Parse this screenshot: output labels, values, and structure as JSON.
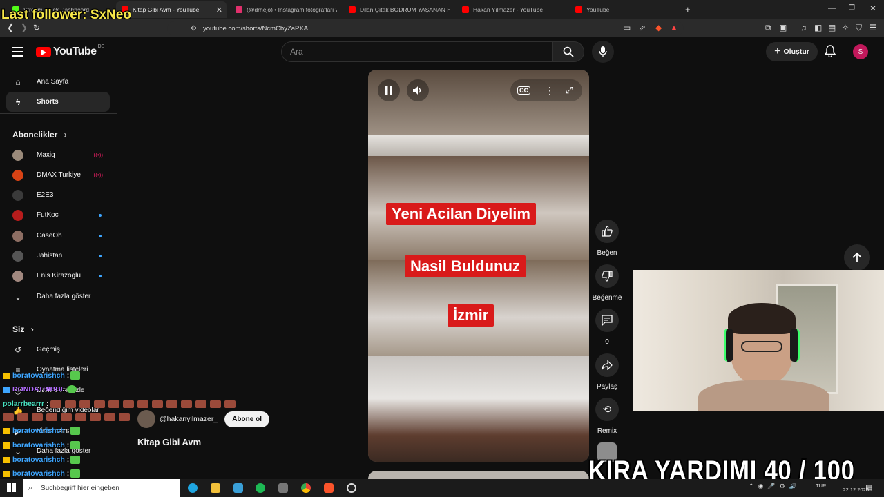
{
  "overlay": {
    "last_follower": "Last follower: SxNeo",
    "goal": "KIRA YARDIMI  40 / 100"
  },
  "browser": {
    "tabs": [
      {
        "label": "Stream - Kick Dashboard",
        "color": "#53fc18",
        "active": false
      },
      {
        "label": "Kitap Gibi Avm - YouTube",
        "color": "#ff0000",
        "active": true
      },
      {
        "label": "(@drhejo) • Instagram fotoğrafları ve",
        "color": "#e1306c",
        "active": false
      },
      {
        "label": "Dilan Çıtak BODRUM YAŞANAN Had",
        "color": "#ff0000",
        "active": false
      },
      {
        "label": "Hakan Yılmazer - YouTube",
        "color": "#ff0000",
        "active": false
      },
      {
        "label": "YouTube",
        "color": "#ff0000",
        "active": false
      }
    ],
    "url": "youtube.com/shorts/NcmCbyZaPXA"
  },
  "youtube": {
    "logo_text": "YouTube",
    "country": "DE",
    "search_placeholder": "Ara",
    "create_label": "Oluştur",
    "avatar_letter": "S",
    "sidebar": {
      "items": [
        {
          "label": "Ana Sayfa",
          "icon": "home-icon"
        },
        {
          "label": "Shorts",
          "icon": "shorts-icon"
        }
      ],
      "subscriptions_title": "Abonelikler",
      "channels": [
        {
          "label": "Maxiq",
          "color": "#9a8a7a",
          "status": "live"
        },
        {
          "label": "DMAX Turkiye",
          "color": "#d84315",
          "status": "live"
        },
        {
          "label": "E2E3",
          "color": "#3a3a3a",
          "status": "none"
        },
        {
          "label": "FutKoc",
          "color": "#b71c1c",
          "status": "new"
        },
        {
          "label": "CaseOh",
          "color": "#8d6e63",
          "status": "new"
        },
        {
          "label": "Jahistan",
          "color": "#555555",
          "status": "new"
        },
        {
          "label": "Enis Kirazoglu",
          "color": "#a1887f",
          "status": "new"
        }
      ],
      "show_more": "Daha fazla göster",
      "you_title": "Siz",
      "you_items": [
        {
          "label": "Geçmiş",
          "icon": "history-icon"
        },
        {
          "label": "Oynatma listeleri",
          "icon": "playlist-icon"
        },
        {
          "label": "Daha sonra izle",
          "icon": "watch-later-icon"
        },
        {
          "label": "Beğendiğim videolar",
          "icon": "like-icon"
        },
        {
          "label": "Videolarınız",
          "icon": "video-icon"
        },
        {
          "label": "Daha fazla göster",
          "icon": "chevron-down-icon"
        }
      ]
    },
    "short": {
      "captions": [
        "Yeni Acilan Diyelim",
        "Nasil Buldunuz",
        "İzmir"
      ],
      "channel": "@hakanyilmazer_",
      "subscribe": "Abone ol",
      "title": "Kitap Gibi Avm"
    },
    "actions": {
      "like": "Beğen",
      "dislike": "Beğenme",
      "comments": "0",
      "share": "Paylaş",
      "remix": "Remix"
    }
  },
  "chat": [
    {
      "user": "boratovarishch",
      "text": ":",
      "color": "#3ea6ff"
    },
    {
      "user": "DONDATHIBBE",
      "text": "",
      "color": "#b36cff"
    },
    {
      "user": "polarrbearrr",
      "text": ":",
      "color": "#48e0c0"
    },
    {
      "user": "boratovarishch",
      "text": ":",
      "color": "#3ea6ff"
    },
    {
      "user": "boratovarishch",
      "text": ":",
      "color": "#3ea6ff"
    },
    {
      "user": "boratovarishch",
      "text": ":",
      "color": "#3ea6ff"
    },
    {
      "user": "boratovarishch",
      "text": ":",
      "color": "#3ea6ff"
    }
  ],
  "taskbar": {
    "search_placeholder": "Suchbegriff hier eingeben",
    "language": "TUR",
    "date": "22.12.2025"
  }
}
